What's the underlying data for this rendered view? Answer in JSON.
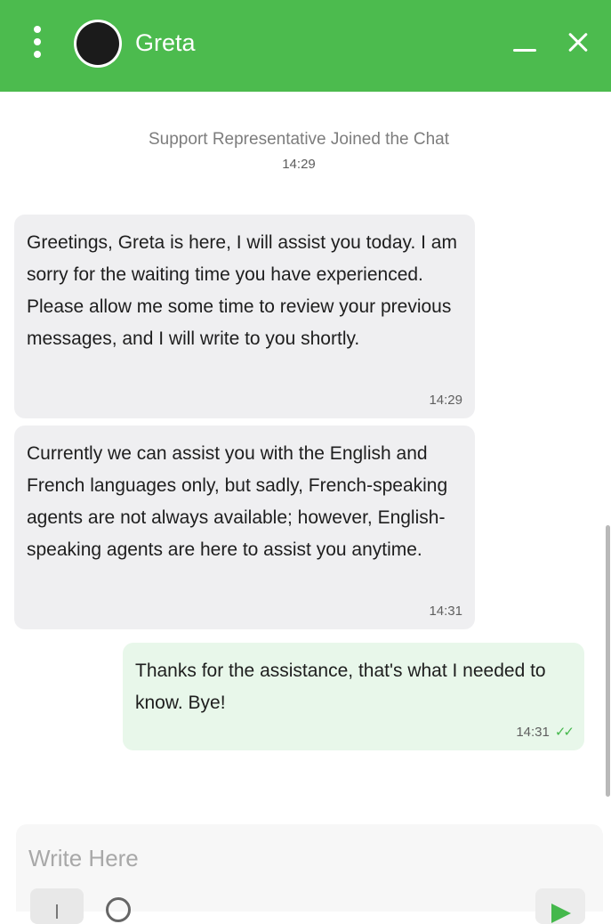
{
  "header": {
    "agent_name": "Greta",
    "background_color": "#4cbb4e",
    "icons": [
      "menu-dots-icon",
      "minimize-icon",
      "close-icon"
    ]
  },
  "system_message": {
    "text": "Support Representative Joined the Chat",
    "time": "14:29"
  },
  "messages": [
    {
      "sender": "agent",
      "text": "Greetings, Greta is here, I will assist you today. I am sorry for the waiting time you have experienced. Please allow me some time to review your previous messages, and I will write to you shortly.",
      "time": "14:29"
    },
    {
      "sender": "agent",
      "text": "Currently we can assist you with the English and French languages only, but sadly, French-speaking agents are not always available; however, English-speaking agents are here to assist you anytime.",
      "time": "14:31"
    },
    {
      "sender": "user",
      "text": "Thanks for the assistance, that's what I needed to know. Bye!",
      "time": "14:31",
      "read_ticks": "✓✓"
    }
  ],
  "composer": {
    "placeholder": "Write Here",
    "icons": [
      "attach-icon",
      "emoji-icon",
      "send-icon"
    ]
  },
  "colors": {
    "accent": "#4cbb4e",
    "agent_bubble": "#efeff1",
    "user_bubble": "#e8f7ea",
    "read_tick": "#45b84c"
  }
}
